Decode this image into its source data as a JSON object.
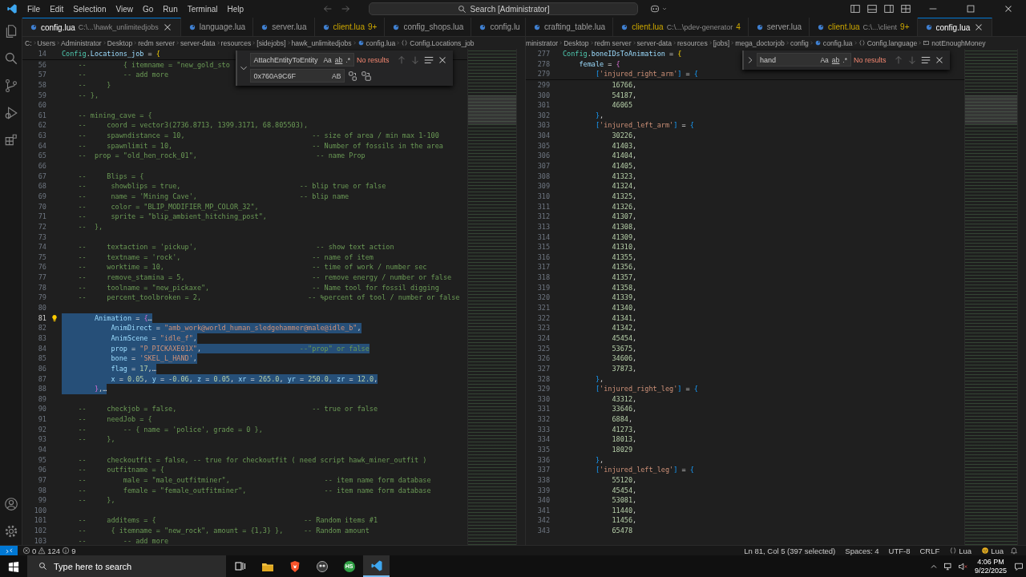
{
  "menu": [
    "File",
    "Edit",
    "Selection",
    "View",
    "Go",
    "Run",
    "Terminal",
    "Help"
  ],
  "command_center": {
    "label": "Search [Administrator]"
  },
  "editors": [
    {
      "tabs": [
        {
          "label": "config.lua",
          "path": "C:\\...\\hawk_unlimitedjobs",
          "warning": false,
          "selected": true
        },
        {
          "label": "language.lua",
          "warning": false,
          "selected": false
        },
        {
          "label": "server.lua",
          "warning": false,
          "selected": false
        },
        {
          "label": "client.lua",
          "badge": "9+",
          "warning": true,
          "selected": false
        },
        {
          "label": "config_shops.lua",
          "warning": false,
          "selected": false
        },
        {
          "label": "config.lu",
          "warning": false,
          "selected": false
        }
      ],
      "breadcrumbs": [
        {
          "text": "C:",
          "kind": "folder"
        },
        {
          "text": "Users",
          "kind": "folder"
        },
        {
          "text": "Administrator",
          "kind": "folder"
        },
        {
          "text": "Desktop",
          "kind": "folder"
        },
        {
          "text": "redm server",
          "kind": "folder"
        },
        {
          "text": "server-data",
          "kind": "folder"
        },
        {
          "text": "resources",
          "kind": "folder"
        },
        {
          "text": "[sidejobs]",
          "kind": "folder"
        },
        {
          "text": "hawk_unlimitedjobs",
          "kind": "folder"
        },
        {
          "text": "config.lua",
          "kind": "file"
        },
        {
          "text": "Config.Locations_job",
          "kind": "symbol"
        }
      ],
      "find": {
        "expanded": true,
        "query": "AttachEntityToEntity",
        "options": [
          "Aa",
          "ab",
          ".*"
        ],
        "result": "No results",
        "replace": "0x760A9C6F",
        "replace_options": [
          "AB"
        ]
      },
      "sticky_lines": [
        {
          "num": "14",
          "text": "Config.Locations_job = {"
        }
      ],
      "lines": [
        {
          "num": "56",
          "text": "    --         { itemname = \"new_gold_sto",
          "selected": false,
          "active": false
        },
        {
          "num": "57",
          "text": "    --         -- add more",
          "selected": false,
          "active": false
        },
        {
          "num": "58",
          "text": "    --     }",
          "selected": false,
          "active": false
        },
        {
          "num": "59",
          "text": "    -- },",
          "selected": false,
          "active": false
        },
        {
          "num": "60",
          "selected": false,
          "active": false
        },
        {
          "num": "61",
          "text": "    -- mining_cave = {",
          "selected": false,
          "active": false
        },
        {
          "num": "62",
          "text": "    --     coord = vector3(2736.8713, 1399.3171, 68.805503),",
          "selected": false,
          "active": false
        },
        {
          "num": "63",
          "text": "    --     spawndistance = 10,                               -- size of area / min max 1-100",
          "selected": false,
          "active": false
        },
        {
          "num": "64",
          "text": "    --     spawnlimit = 10,                                  -- Number of fossils in the area",
          "selected": false,
          "active": false
        },
        {
          "num": "65",
          "text": "    --  prop = \"old_hen_rock_01\",                             -- name Prop",
          "selected": false,
          "active": false
        },
        {
          "num": "66",
          "selected": false,
          "active": false
        },
        {
          "num": "67",
          "text": "    --     Blips = {",
          "selected": false,
          "active": false
        },
        {
          "num": "68",
          "text": "    --      showblips = true,                             -- blip true or false",
          "selected": false,
          "active": false
        },
        {
          "num": "69",
          "text": "    --      name = 'Mining Cave',                         -- blip name",
          "selected": false,
          "active": false
        },
        {
          "num": "70",
          "text": "    --      color = \"BLIP_MODIFIER_MP_COLOR_32\",",
          "selected": false,
          "active": false
        },
        {
          "num": "71",
          "text": "    --      sprite = \"blip_ambient_hitching_post\",",
          "selected": false,
          "active": false
        },
        {
          "num": "72",
          "text": "    --  },",
          "selected": false,
          "active": false
        },
        {
          "num": "73",
          "selected": false,
          "active": false
        },
        {
          "num": "74",
          "text": "    --     textaction = 'pickup',                             -- show text action",
          "selected": false,
          "active": false
        },
        {
          "num": "75",
          "text": "    --     textname = 'rock',                                -- name of item",
          "selected": false,
          "active": false
        },
        {
          "num": "76",
          "text": "    --     worktime = 10,                                    -- time of work / number sec",
          "selected": false,
          "active": false
        },
        {
          "num": "77",
          "text": "    --     remove_stamina = 5,                               -- remove energy / number or false",
          "selected": false,
          "active": false
        },
        {
          "num": "78",
          "text": "    --     toolname = \"new_pickaxe\",                         -- Name tool for fossil digging",
          "selected": false,
          "active": false
        },
        {
          "num": "79",
          "text": "    --     percent_toolbroken = 2,                          -- %percent of tool / number or false",
          "selected": false,
          "active": false
        },
        {
          "num": "80",
          "selected": false,
          "active": false
        },
        {
          "num": "81",
          "text": "        Animation = {…",
          "selected": true,
          "active": true
        },
        {
          "num": "82",
          "text": "            AnimDirect = \"amb_work@world_human_sledgehammer@male@idle_b\",",
          "selected": true,
          "active": false
        },
        {
          "num": "83",
          "text": "            AnimScene = \"idle_f\",",
          "selected": true,
          "active": false
        },
        {
          "num": "84",
          "text": "            prop = \"P_PICKAXE01X\",                        --\"prop\" or false",
          "selected": true,
          "active": false
        },
        {
          "num": "85",
          "text": "            bone = 'SKEL_L_HAND',",
          "selected": true,
          "active": false
        },
        {
          "num": "86",
          "text": "            flag = 17,…",
          "selected": true,
          "active": false
        },
        {
          "num": "87",
          "text": "            x = 0.05, y = -0.06, z = 0.05, xr = 265.0, yr = 250.0, zr = 12.0,",
          "selected": true,
          "active": false
        },
        {
          "num": "88",
          "text": "        },…",
          "selected": true,
          "active": false
        },
        {
          "num": "89",
          "selected": false,
          "active": false
        },
        {
          "num": "90",
          "text": "    --     checkjob = false,                                 -- true or false",
          "selected": false,
          "active": false
        },
        {
          "num": "91",
          "text": "    --     needJob = {",
          "selected": false,
          "active": false
        },
        {
          "num": "92",
          "text": "    --         -- { name = 'police', grade = 0 },",
          "selected": false,
          "active": false
        },
        {
          "num": "93",
          "text": "    --     },",
          "selected": false,
          "active": false
        },
        {
          "num": "94",
          "selected": false,
          "active": false
        },
        {
          "num": "95",
          "text": "    --     checkoutfit = false, -- true for checkoutfit ( need script hawk_miner_outfit )",
          "selected": false,
          "active": false
        },
        {
          "num": "96",
          "text": "    --     outfitname = {",
          "selected": false,
          "active": false
        },
        {
          "num": "97",
          "text": "    --         male = \"male_outfitminer\",                       -- item name form database",
          "selected": false,
          "active": false
        },
        {
          "num": "98",
          "text": "    --         female = \"female_outfitminer\",                   -- item name form database",
          "selected": false,
          "active": false
        },
        {
          "num": "99",
          "text": "    --     },",
          "selected": false,
          "active": false
        },
        {
          "num": "100",
          "selected": false,
          "active": false
        },
        {
          "num": "101",
          "text": "    --     additems = {                                    -- Random items #1",
          "selected": false,
          "active": false
        },
        {
          "num": "102",
          "text": "    --      { itemname = \"new_rock\", amount = {1,3} },     -- Random amount",
          "selected": false,
          "active": false
        },
        {
          "num": "103",
          "text": "    --         -- add more",
          "selected": false,
          "active": false
        }
      ]
    },
    {
      "tabs": [
        {
          "label": "crafting_table.lua",
          "warning": false,
          "selected": false
        },
        {
          "label": "client.lua",
          "path": "C:\\...\\pdev-generator",
          "badge": "4",
          "warning": true,
          "selected": false
        },
        {
          "label": "server.lua",
          "warning": false,
          "selected": false
        },
        {
          "label": "client.lua",
          "path": "C:\\...\\client",
          "badge": "9+",
          "warning": true,
          "selected": false
        },
        {
          "label": "config.lua",
          "warning": false,
          "selected": true
        }
      ],
      "breadcrumbs": [
        {
          "text": "ministrator",
          "kind": "folder"
        },
        {
          "text": "Desktop",
          "kind": "folder"
        },
        {
          "text": "redm server",
          "kind": "folder"
        },
        {
          "text": "server-data",
          "kind": "folder"
        },
        {
          "text": "resources",
          "kind": "folder"
        },
        {
          "text": "[jobs]",
          "kind": "folder"
        },
        {
          "text": "mega_doctorjob",
          "kind": "folder"
        },
        {
          "text": "config",
          "kind": "folder"
        },
        {
          "text": "config.lua",
          "kind": "file"
        },
        {
          "text": "Config.language",
          "kind": "symbol"
        },
        {
          "text": "notEnoughMoney",
          "kind": "property"
        }
      ],
      "find": {
        "expanded": false,
        "query": "hand",
        "options": [
          "Aa",
          "ab",
          ".*"
        ],
        "result": "No results"
      },
      "sticky_lines": [
        {
          "num": "277",
          "text": "Config.boneIDsToAnimation = {"
        },
        {
          "num": "278",
          "text": "    female = {"
        },
        {
          "num": "279",
          "text": "        ['injured_right_arm'] = {"
        }
      ],
      "lines": [
        {
          "num": "299",
          "text": "            16766,",
          "selected": false,
          "active": false
        },
        {
          "num": "300",
          "text": "            54187,",
          "selected": false,
          "active": false
        },
        {
          "num": "301",
          "text": "            46065",
          "selected": false,
          "active": false
        },
        {
          "num": "302",
          "text": "        },",
          "selected": false,
          "active": false
        },
        {
          "num": "303",
          "text": "        ['injured_left_arm'] = {",
          "selected": false,
          "active": false
        },
        {
          "num": "304",
          "text": "            30226,",
          "selected": false,
          "active": false
        },
        {
          "num": "305",
          "text": "            41403,",
          "selected": false,
          "active": false
        },
        {
          "num": "306",
          "text": "            41404,",
          "selected": false,
          "active": false
        },
        {
          "num": "307",
          "text": "            41405,",
          "selected": false,
          "active": false
        },
        {
          "num": "308",
          "text": "            41323,",
          "selected": false,
          "active": false
        },
        {
          "num": "309",
          "text": "            41324,",
          "selected": false,
          "active": false
        },
        {
          "num": "310",
          "text": "            41325,",
          "selected": false,
          "active": false
        },
        {
          "num": "311",
          "text": "            41326,",
          "selected": false,
          "active": false
        },
        {
          "num": "312",
          "text": "            41307,",
          "selected": false,
          "active": false
        },
        {
          "num": "313",
          "text": "            41308,",
          "selected": false,
          "active": false
        },
        {
          "num": "314",
          "text": "            41309,",
          "selected": false,
          "active": false
        },
        {
          "num": "315",
          "text": "            41310,",
          "selected": false,
          "active": false
        },
        {
          "num": "316",
          "text": "            41355,",
          "selected": false,
          "active": false
        },
        {
          "num": "317",
          "text": "            41356,",
          "selected": false,
          "active": false
        },
        {
          "num": "318",
          "text": "            41357,",
          "selected": false,
          "active": false
        },
        {
          "num": "319",
          "text": "            41358,",
          "selected": false,
          "active": false
        },
        {
          "num": "320",
          "text": "            41339,",
          "selected": false,
          "active": false
        },
        {
          "num": "321",
          "text": "            41340,",
          "selected": false,
          "active": false
        },
        {
          "num": "322",
          "text": "            41341,",
          "selected": false,
          "active": false
        },
        {
          "num": "323",
          "text": "            41342,",
          "selected": false,
          "active": false
        },
        {
          "num": "324",
          "text": "            45454,",
          "selected": false,
          "active": false
        },
        {
          "num": "325",
          "text": "            53675,",
          "selected": false,
          "active": false
        },
        {
          "num": "326",
          "text": "            34606,",
          "selected": false,
          "active": false
        },
        {
          "num": "327",
          "text": "            37873,",
          "selected": false,
          "active": false
        },
        {
          "num": "328",
          "text": "        },",
          "selected": false,
          "active": false
        },
        {
          "num": "329",
          "text": "        ['injured_right_leg'] = {",
          "selected": false,
          "active": false
        },
        {
          "num": "330",
          "text": "            43312,",
          "selected": false,
          "active": false
        },
        {
          "num": "331",
          "text": "            33646,",
          "selected": false,
          "active": false
        },
        {
          "num": "332",
          "text": "            6884,",
          "selected": false,
          "active": false
        },
        {
          "num": "333",
          "text": "            41273,",
          "selected": false,
          "active": false
        },
        {
          "num": "334",
          "text": "            18013,",
          "selected": false,
          "active": false
        },
        {
          "num": "335",
          "text": "            18029",
          "selected": false,
          "active": false
        },
        {
          "num": "336",
          "text": "        },",
          "selected": false,
          "active": false
        },
        {
          "num": "337",
          "text": "        ['injured_left_leg'] = {",
          "selected": false,
          "active": false
        },
        {
          "num": "338",
          "text": "            55120,",
          "selected": false,
          "active": false
        },
        {
          "num": "339",
          "text": "            45454,",
          "selected": false,
          "active": false
        },
        {
          "num": "340",
          "text": "            53081,",
          "selected": false,
          "active": false
        },
        {
          "num": "341",
          "text": "            11440,",
          "selected": false,
          "active": false
        },
        {
          "num": "342",
          "text": "            11456,",
          "selected": false,
          "active": false
        },
        {
          "num": "343",
          "text": "            65478",
          "selected": false,
          "active": false
        }
      ]
    }
  ],
  "status_bar": {
    "errors": "0",
    "warnings": "124",
    "infos": "9",
    "cursor": "Ln 81, Col 5 (397 selected)",
    "indent": "Spaces: 4",
    "encoding": "UTF-8",
    "eol": "CRLF",
    "language": "Lua",
    "formatter": "Lua"
  },
  "taskbar": {
    "search_placeholder": "Type here to search",
    "apps": [
      {
        "active": false
      },
      {
        "active": false
      },
      {
        "active": false
      },
      {
        "active": false
      },
      {
        "label": "HS",
        "active": false
      },
      {
        "active": true
      }
    ],
    "time": "4:06 PM",
    "date": "9/22/2025"
  }
}
